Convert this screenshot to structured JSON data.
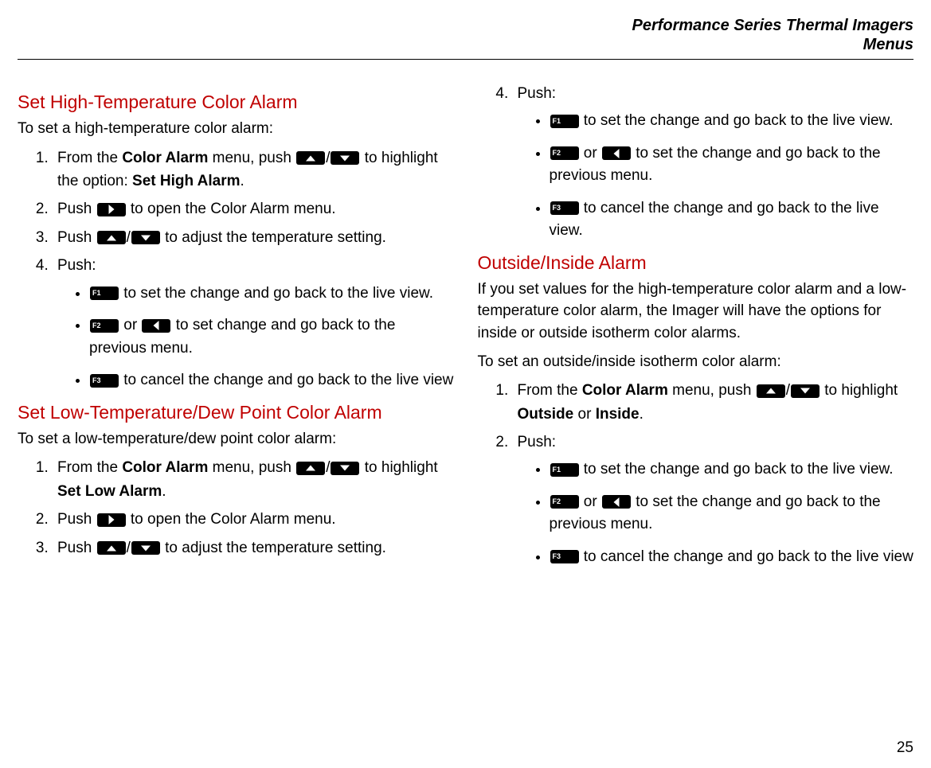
{
  "header": {
    "line1": "Performance Series Thermal Imagers",
    "line2": "Menus"
  },
  "keys": {
    "f1": "F1",
    "f2": "F2",
    "f3": "F3"
  },
  "left": {
    "sec1": {
      "title": "Set High-Temperature Color Alarm",
      "intro": "To set a high-temperature color alarm:",
      "li1a": "From the ",
      "li1b": "Color Alarm",
      "li1c": " menu, push ",
      "li1d": " to highlight the option: ",
      "li1e": "Set High Alarm",
      "li1f": ".",
      "li2a": "Push ",
      "li2b": " to open the Color Alarm menu.",
      "li3a": "Push ",
      "li3b": " to adjust the temperature setting.",
      "li4": "Push:",
      "b1": " to set the change and go back to the live view.",
      "b2a": " or ",
      "b2b": " to set change and go back to the previous menu.",
      "b3": " to cancel the change and go back to the live view"
    },
    "sec2": {
      "title": "Set Low-Temperature/Dew Point Color Alarm",
      "intro": "To set a low-temperature/dew point color alarm:",
      "li1a": "From the ",
      "li1b": "Color Alarm",
      "li1c": " menu, push ",
      "li1d": " to highlight ",
      "li1e": "Set Low Alarm",
      "li1f": ".",
      "li2a": "Push ",
      "li2b": " to open the Color Alarm menu.",
      "li3a": "Push ",
      "li3b": " to adjust the temperature setting."
    }
  },
  "right": {
    "cont": {
      "li4": "Push:",
      "b1": " to set the change and go back to the live view.",
      "b2a": " or ",
      "b2b": " to set the change and go back to the previous menu.",
      "b3": " to cancel the change and go back to the live view."
    },
    "sec3": {
      "title": "Outside/Inside Alarm",
      "para1": "If you set values for the high-temperature color alarm and a low-temperature color alarm, the Imager will have the options for inside or outside isotherm color alarms.",
      "intro": "To set an outside/inside isotherm color alarm:",
      "li1a": "From the ",
      "li1b": "Color Alarm",
      "li1c": " menu, push ",
      "li1d": " to highlight ",
      "li1e": "Outside",
      "li1f": " or ",
      "li1g": "Inside",
      "li1h": ".",
      "li2": "Push:",
      "b1": " to set the change and go back to the live view.",
      "b2a": " or ",
      "b2b": " to set the change and go back to the previous menu.",
      "b3": " to cancel the change and go back to the live view"
    }
  },
  "page": "25"
}
